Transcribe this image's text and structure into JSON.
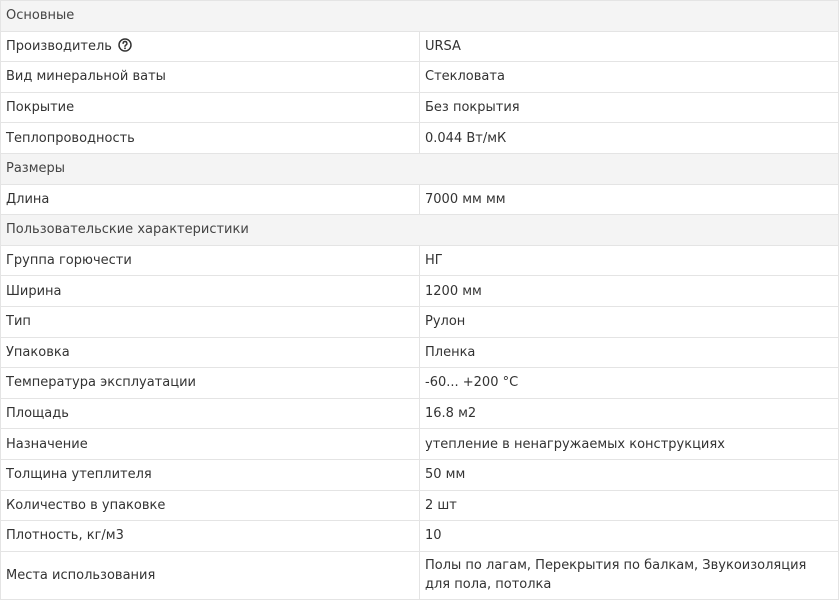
{
  "sections": {
    "basic": "Основные",
    "sizes": "Размеры",
    "custom": "Пользовательские характеристики"
  },
  "rows": {
    "manufacturer": {
      "label": "Производитель",
      "value": "URSA",
      "help_icon": "question-circle-icon"
    },
    "wool_type": {
      "label": "Вид минеральной ваты",
      "value": "Стекловата"
    },
    "coating": {
      "label": "Покрытие",
      "value": "Без покрытия"
    },
    "conductivity": {
      "label": "Теплопроводность",
      "value": "0.044 Вт/мК"
    },
    "length": {
      "label": "Длина",
      "value": "7000 мм мм"
    },
    "flammability": {
      "label": "Группа горючести",
      "value": "НГ"
    },
    "width": {
      "label": "Ширина",
      "value": "1200 мм"
    },
    "type": {
      "label": "Тип",
      "value": "Рулон"
    },
    "package": {
      "label": "Упаковка",
      "value": "Пленка"
    },
    "temperature": {
      "label": "Температура эксплуатации",
      "value": "-60... +200 °С"
    },
    "area": {
      "label": "Площадь",
      "value": "16.8 м2"
    },
    "purpose": {
      "label": "Назначение",
      "value": "утепление в ненагружаемых конструкциях"
    },
    "thickness": {
      "label": "Толщина утеплителя",
      "value": "50 мм"
    },
    "quantity": {
      "label": "Количество в упаковке",
      "value": "2 шт"
    },
    "density": {
      "label": "Плотность, кг/м3",
      "value": "10"
    },
    "usage": {
      "label": "Места использования",
      "value": "Полы по лагам, Перекрытия по балкам, Звукоизоляция для пола, потолка"
    }
  }
}
